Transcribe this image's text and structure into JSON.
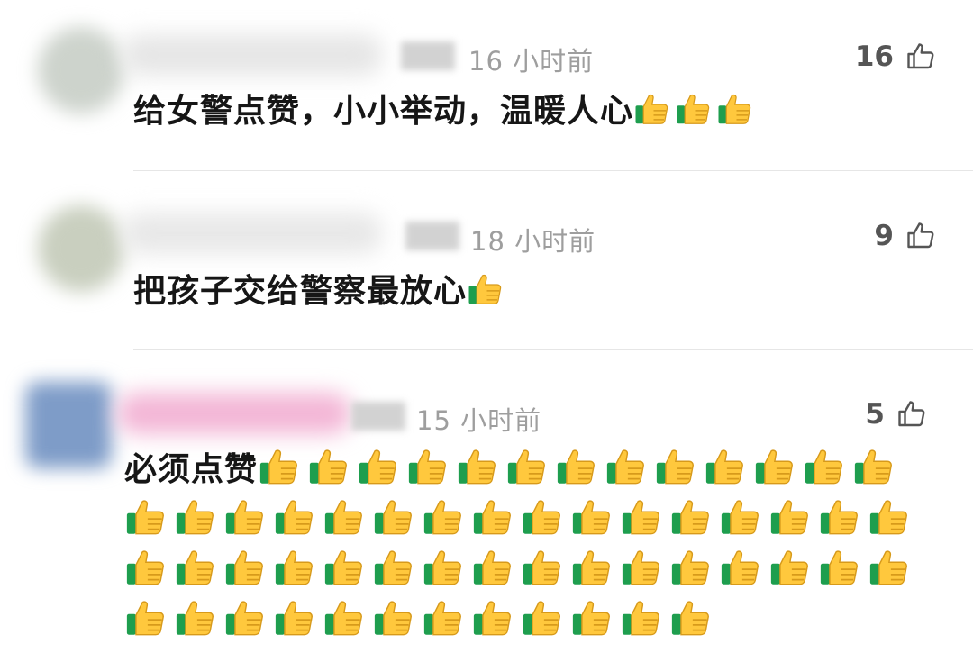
{
  "comments": [
    {
      "time": "16 小时前",
      "likes": "16",
      "text": "给女警点赞，小小举动，温暖人心",
      "thumbs_count": 3,
      "avatar_color": "#cdd3cc",
      "name_color": "#e6e6e6"
    },
    {
      "time": "18 小时前",
      "likes": "9",
      "text": "把孩子交给警察最放心",
      "thumbs_count": 1,
      "avatar_color": "#c9cfbf",
      "name_color": "#e8e8e8"
    },
    {
      "time": "15 小时前",
      "likes": "5",
      "text": "必须点赞",
      "thumbs_count": 57,
      "avatar_color": "#7e9cc8",
      "name_color": "#f3b6d6"
    }
  ],
  "icons": {
    "like": "thumbs-up-outline-icon",
    "emoji": "thumbs-up-emoji-icon"
  },
  "colors": {
    "emoji_yellow": "#ffc83d",
    "emoji_cuff": "#1e9e4e",
    "time_gray": "#9e9e9e"
  }
}
